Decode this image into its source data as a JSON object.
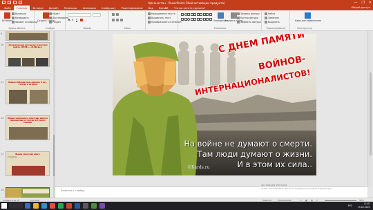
{
  "window": {
    "title": "Афганистан - PowerPoint (Сбой активации продукта)",
    "controls": [
      "—",
      "❐",
      "✕"
    ]
  },
  "ribbon_tabs": [
    "Файл",
    "Главная",
    "Вставка",
    "Дизайн",
    "Переходы",
    "Анимация",
    "Слайд-шоу",
    "Рецензирование",
    "Вид",
    "Всеобй",
    "Что вы хотите сделать?"
  ],
  "active_tab": "Главная",
  "share_label": "Общий доступ",
  "ribbon": {
    "paste": "Вставить",
    "clipboard": [
      "Вырезать",
      "Копировать",
      "Формат по образцу"
    ],
    "clipboard_label": "Буфер обмена",
    "new_slide": "Создать слайд",
    "slide_opts": [
      "Макет",
      "Восстановить",
      "Раздел"
    ],
    "slides_label": "Слайды",
    "font_label": "Шрифт",
    "paragraph_label": "Абзац",
    "text_opts": [
      "Направление текста",
      "Выровнять текст",
      "Преобразовать в SmartArt"
    ],
    "drawing_label": "Рисование",
    "arrange": "Упорядочить",
    "quick_styles": "Экспресс-стили",
    "shape_opts": [
      "Заливка фигуры",
      "Контур фигуры",
      "Эффекты фигуры"
    ],
    "editing": [
      "Найти",
      "Заменить",
      "Выделить"
    ],
    "editing_label": "Редактирование",
    "design_ideas": "Идеи для оформления",
    "designer_label": "Конструктор"
  },
  "thumbnails": [
    {
      "num": "9",
      "title": "",
      "body": ""
    },
    {
      "num": "10",
      "title": "«Ограниченный контингент советских войск» (ОКСВ — «В Афган»)",
      "body": ""
    },
    {
      "num": "11",
      "title": "Война в Афганистане длилась 9 лет, 1 месяц и 18 дней",
      "body": ""
    },
    {
      "num": "12",
      "title": "Общая численность советских войск в Афганистане от 100 до 115 тысяч человек",
      "body": ""
    },
    {
      "num": "13",
      "title": "Вывод советских войск",
      "body": "15 февраля…"
    },
    {
      "num": "14",
      "title": "",
      "body": ""
    }
  ],
  "slide": {
    "headline_line1": "С ДНЕМ ПАМЯТИ",
    "headline_line2": "ВОЙНОВ-",
    "headline_line3": "ИНТЕРНАЦИОНАЛИСТОВ!",
    "quote_line1": "На войне не думают о смерти.",
    "quote_line2": "Там люди думают о жизни.",
    "quote_line3": "И в этом их сила..",
    "watermark": "©Kards.ru"
  },
  "notes_placeholder": "Заметки к слайду",
  "status": {
    "slide_info": "Слайд 14 из 15",
    "language": "русский",
    "notes": "Заметки",
    "comments": "Примечания",
    "zoom": "56%"
  },
  "activation": {
    "line1": "Активация Windows",
    "line2": "Чтобы активировать Windows, перейдите в раздел \"Параметры\"."
  },
  "taskbar": {
    "time": "11:07",
    "date": "15.02.2021",
    "lang": "РУС"
  }
}
